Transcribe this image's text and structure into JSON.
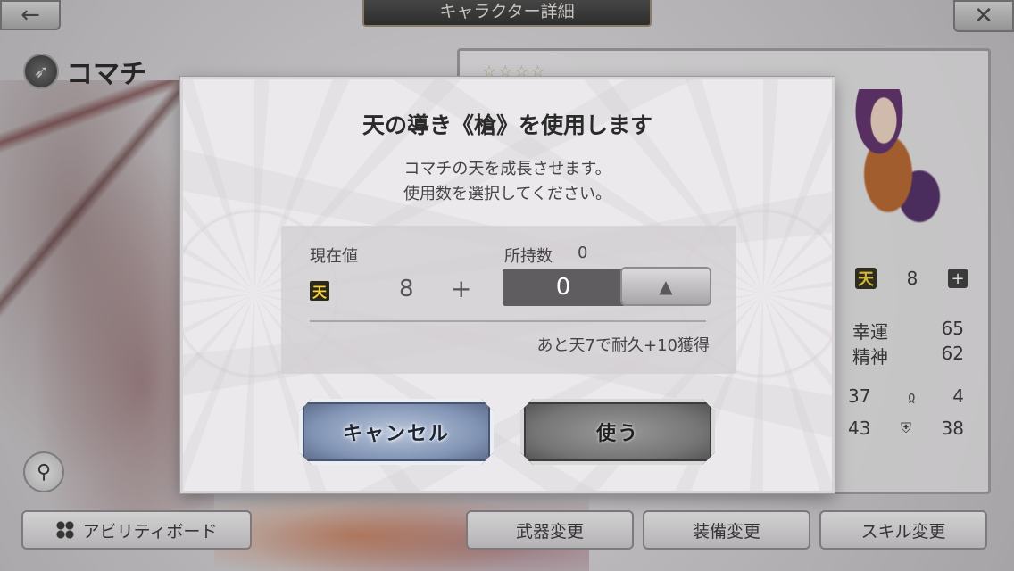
{
  "screen": {
    "title": "キャラクター詳細",
    "back_icon": "←",
    "close_icon": "✕",
    "character_name": "コマチ",
    "stars": "☆☆☆☆",
    "stats": {
      "ten_value": "8",
      "luck_label": "幸運",
      "luck_value": "65",
      "spirit_label": "精神",
      "spirit_value": "62",
      "row1_left": "37",
      "row1_right": "4",
      "row2_left": "43",
      "row2_right": "38"
    },
    "bottom_buttons": {
      "ability_board": "アビリティボード",
      "weapon_change": "武器変更",
      "equip_change": "装備変更",
      "skill_change": "スキル変更"
    }
  },
  "dialog": {
    "title": "天の導き《槍》を使用します",
    "desc_line1": "コマチの天を成長させます。",
    "desc_line2": "使用数を選択してください。",
    "current_label": "現在値",
    "owned_label": "所持数",
    "owned_count": "0",
    "ten_glyph": "天",
    "current_value": "8",
    "plus": "+",
    "stepper_value": "0",
    "stepper_up_glyph": "▲",
    "hint": "あと天7で耐久+10獲得",
    "cancel_label": "キャンセル",
    "use_label": "使う"
  }
}
